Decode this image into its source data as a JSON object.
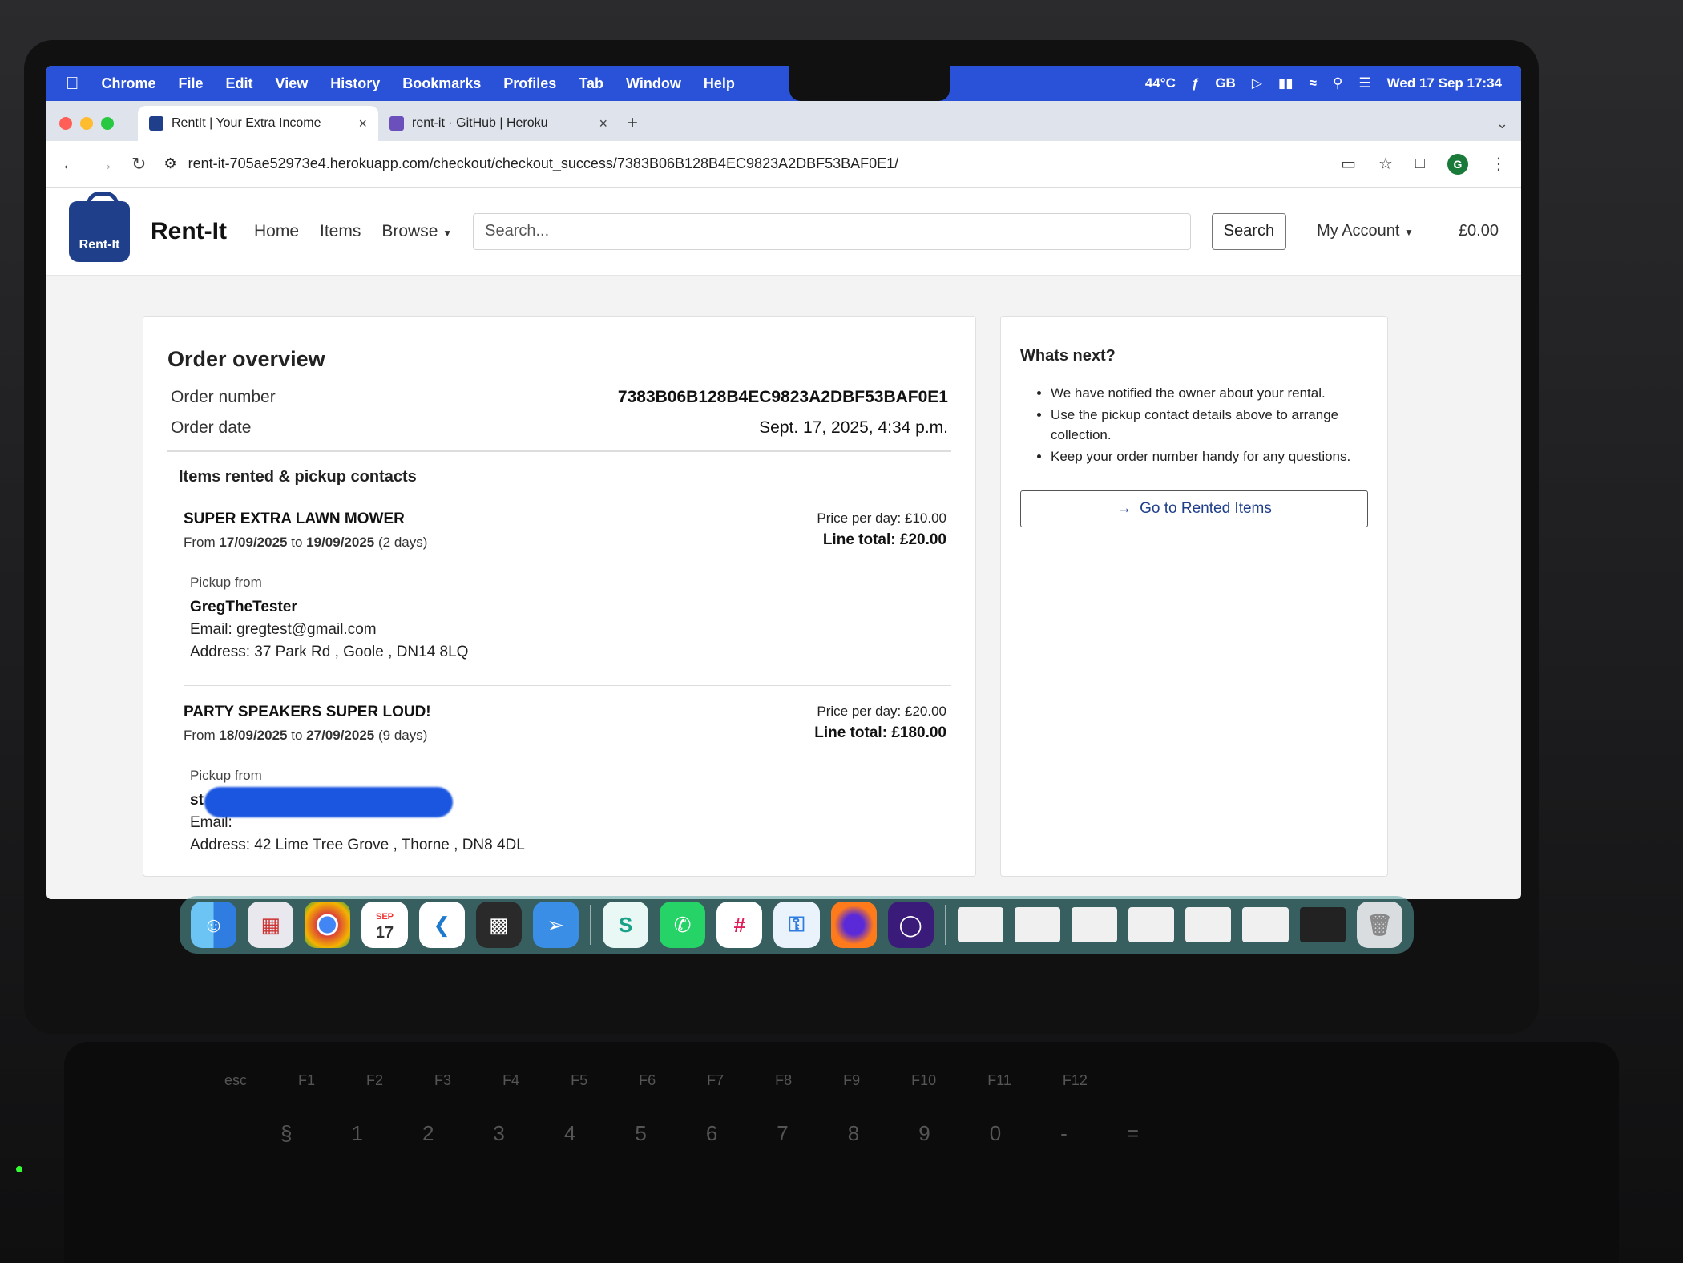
{
  "menubar": {
    "app": "Chrome",
    "items": [
      "File",
      "Edit",
      "View",
      "History",
      "Bookmarks",
      "Profiles",
      "Tab",
      "Window",
      "Help"
    ],
    "temperature": "44°C",
    "input_source": "GB",
    "datetime": "Wed 17 Sep  17:34"
  },
  "tabs": [
    {
      "title": "RentIt | Your Extra Income",
      "active": true
    },
    {
      "title": "rent-it · GitHub | Heroku",
      "active": false
    }
  ],
  "address_bar": {
    "url": "rent-it-705ae52973e4.herokuapp.com/checkout/checkout_success/7383B06B128B4EC9823A2DBF53BAF0E1/",
    "profile_initial": "G"
  },
  "site_nav": {
    "logo_text": "Rent-It",
    "brand": "Rent-It",
    "links": [
      "Home",
      "Items",
      "Browse"
    ],
    "search_placeholder": "Search...",
    "search_button": "Search",
    "account": "My Account",
    "balance": "£0.00"
  },
  "order": {
    "heading": "Order overview",
    "number_label": "Order number",
    "number": "7383B06B128B4EC9823A2DBF53BAF0E1",
    "date_label": "Order date",
    "date": "Sept. 17, 2025, 4:34 p.m.",
    "items_heading": "Items rented & pickup contacts",
    "items": [
      {
        "name": "SUPER EXTRA LAWN MOWER",
        "from_word": "From",
        "from": "17/09/2025",
        "to_word": "to",
        "to": "19/09/2025",
        "days": "(2 days)",
        "price_per_day": "Price per day: £10.00",
        "line_total": "Line total: £20.00",
        "pickup_label": "Pickup from",
        "owner": "GregTheTester",
        "email": "Email: gregtest@gmail.com",
        "address": "Address: 37 Park Rd , Goole , DN14 8LQ"
      },
      {
        "name": "PARTY SPEAKERS SUPER LOUD!",
        "from_word": "From",
        "from": "18/09/2025",
        "to_word": "to",
        "to": "27/09/2025",
        "days": "(9 days)",
        "price_per_day": "Price per day: £20.00",
        "line_total": "Line total: £180.00",
        "pickup_label": "Pickup from",
        "owner": "st",
        "email": "Email:",
        "address": "Address: 42 Lime Tree Grove , Thorne , DN8 4DL"
      }
    ]
  },
  "whats_next": {
    "title": "Whats next?",
    "bullets": [
      "We have notified the owner about your rental.",
      "Use the pickup contact details above to arrange collection.",
      "Keep your order number handy for any questions."
    ],
    "button": "Go to Rented Items"
  },
  "dock": {
    "calendar_month": "SEP",
    "calendar_day": "17"
  },
  "keyboard": {
    "fn_labels": [
      "esc",
      "F1",
      "F2",
      "F3",
      "F4",
      "F5",
      "F6",
      "F7",
      "F8",
      "F9",
      "F10",
      "F11",
      "F12"
    ],
    "number_keys": [
      "§",
      "1",
      "2",
      "3",
      "4",
      "5",
      "6",
      "7",
      "8",
      "9",
      "0",
      "-",
      "="
    ]
  }
}
